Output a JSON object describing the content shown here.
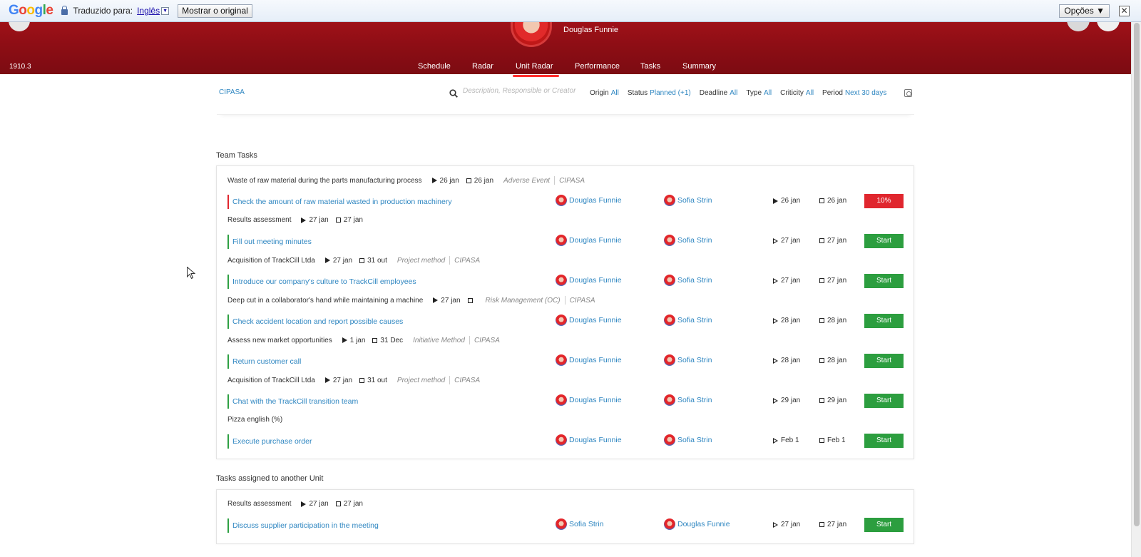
{
  "translate_bar": {
    "logo_letters": [
      "G",
      "o",
      "o",
      "g",
      "l",
      "e"
    ],
    "label": "Traduzido para:",
    "language": "Inglês",
    "dropdown": "▼",
    "show_original": "Mostrar o original",
    "options": "Opções ▼",
    "close": "✕"
  },
  "header": {
    "user_name": "Douglas Funnie",
    "version": "1910.3",
    "tabs": [
      {
        "label": "Schedule"
      },
      {
        "label": "Radar"
      },
      {
        "label": "Unit Radar"
      },
      {
        "label": "Performance"
      },
      {
        "label": "Tasks"
      },
      {
        "label": "Summary"
      }
    ],
    "active_tab": "Unit Radar"
  },
  "filter_bar": {
    "unit": "CIPASA",
    "search_placeholder": "Description, Responsible or Creator",
    "filters": [
      {
        "label": "Origin",
        "value": "All"
      },
      {
        "label": "Status",
        "value": "Planned (+1)"
      },
      {
        "label": "Deadline",
        "value": "All"
      },
      {
        "label": "Type",
        "value": "All"
      },
      {
        "label": "Criticity",
        "value": "All"
      },
      {
        "label": "Period",
        "value": "Next 30 days"
      }
    ]
  },
  "team_tasks": {
    "title": "Team Tasks",
    "tasks": [
      {
        "context": "Waste of raw material during the parts manufacturing process",
        "ctx_start": "26 jan",
        "ctx_end": "26 jan",
        "tag": "Adverse Event",
        "unit": "CIPASA",
        "title": "Check the amount of raw material wasted in production machinery",
        "responsible": "Douglas Funnie",
        "creator": "Sofia Strin",
        "start": "26 jan",
        "end": "26 jan",
        "action": "10%",
        "status": "late"
      },
      {
        "context": "Results assessment",
        "ctx_start": "27 jan",
        "ctx_end": "27 jan",
        "tag": "",
        "unit": "",
        "title": "Fill out meeting minutes",
        "responsible": "Douglas Funnie",
        "creator": "Sofia Strin",
        "start": "27 jan",
        "end": "27 jan",
        "action": "Start",
        "status": "planned"
      },
      {
        "context": "Acquisition of TrackCill Ltda",
        "ctx_start": "27 jan",
        "ctx_end": "31 out",
        "tag": "Project method",
        "unit": "CIPASA",
        "title": "Introduce our company's culture to TrackCill employees",
        "responsible": "Douglas Funnie",
        "creator": "Sofia Strin",
        "start": "27 jan",
        "end": "27 jan",
        "action": "Start",
        "status": "planned"
      },
      {
        "context": "Deep cut in a collaborator's hand while maintaining a machine",
        "ctx_start": "27 jan",
        "ctx_end": "",
        "tag": "Risk Management (OC)",
        "unit": "CIPASA",
        "title": "Check accident location and report possible causes",
        "responsible": "Douglas Funnie",
        "creator": "Sofia Strin",
        "start": "28 jan",
        "end": "28 jan",
        "action": "Start",
        "status": "planned"
      },
      {
        "context": "Assess new market opportunities",
        "ctx_start": "1 jan",
        "ctx_end": "31 Dec",
        "tag": "Initiative Method",
        "unit": "CIPASA",
        "title": "Return customer call",
        "responsible": "Douglas Funnie",
        "creator": "Sofia Strin",
        "start": "28 jan",
        "end": "28 jan",
        "action": "Start",
        "status": "planned"
      },
      {
        "context": "Acquisition of TrackCill Ltda",
        "ctx_start": "27 jan",
        "ctx_end": "31 out",
        "tag": "Project method",
        "unit": "CIPASA",
        "title": "Chat with the TrackCill transition team",
        "responsible": "Douglas Funnie",
        "creator": "Sofia Strin",
        "start": "29 jan",
        "end": "29 jan",
        "action": "Start",
        "status": "planned"
      },
      {
        "context": "Pizza english (%)",
        "ctx_start": "",
        "ctx_end": "",
        "tag": "",
        "unit": "",
        "title": "Execute purchase order",
        "responsible": "Douglas Funnie",
        "creator": "Sofia Strin",
        "start": "Feb 1",
        "end": "Feb 1",
        "action": "Start",
        "status": "planned"
      }
    ]
  },
  "other_unit_tasks": {
    "title": "Tasks assigned to another Unit",
    "tasks": [
      {
        "context": "Results assessment",
        "ctx_start": "27 jan",
        "ctx_end": "27 jan",
        "tag": "",
        "unit": "",
        "title": "Discuss supplier participation in the meeting",
        "responsible": "Sofia Strin",
        "creator": "Douglas Funnie",
        "start": "27 jan",
        "end": "27 jan",
        "action": "Start",
        "status": "planned"
      }
    ]
  },
  "colors": {
    "header_red": "#8e0e15",
    "link_blue": "#2e86c1",
    "start_green": "#2c9e3f",
    "late_red": "#e0262e"
  }
}
